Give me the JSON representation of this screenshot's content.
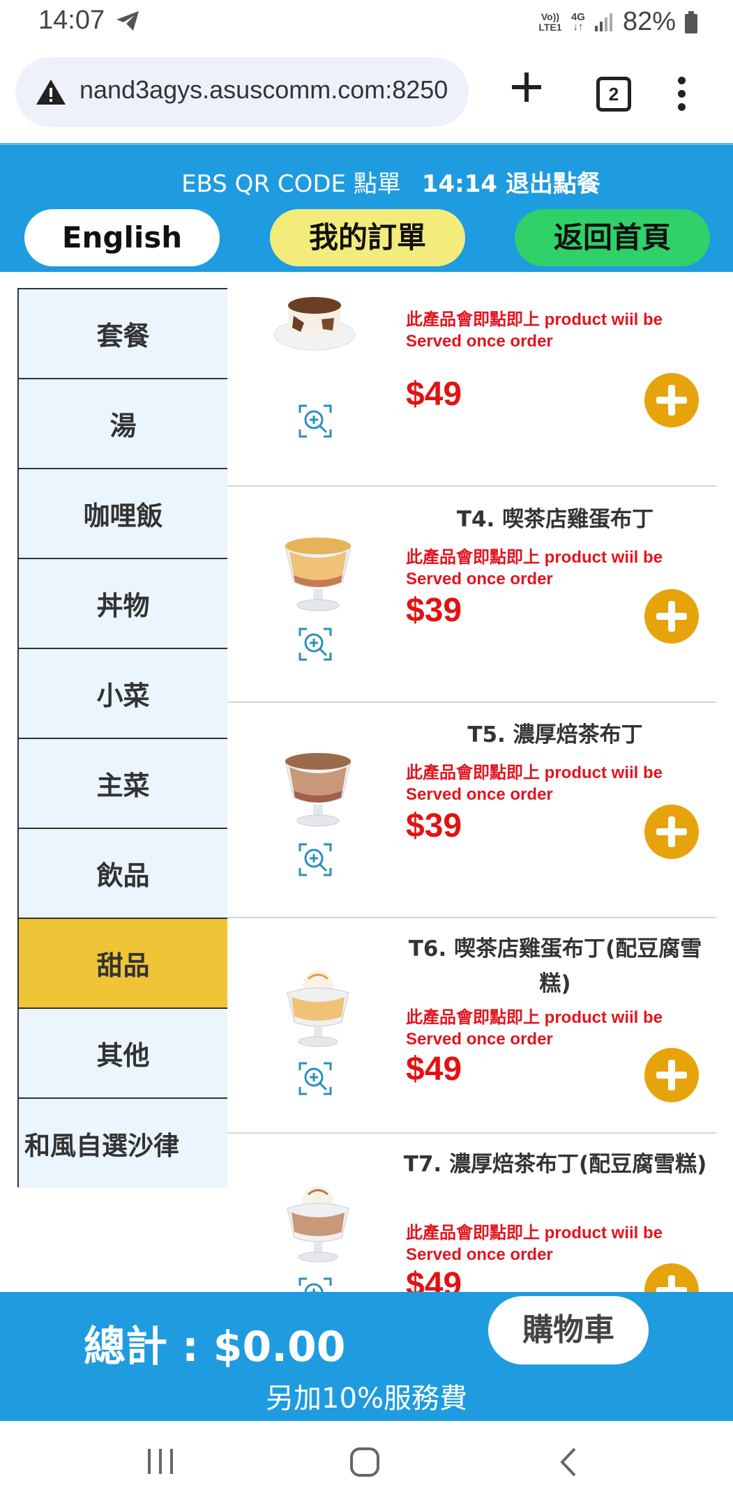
{
  "status_bar": {
    "time": "14:07",
    "volte_label": "Vo)) LTE1",
    "network": "4G",
    "battery": "82%"
  },
  "browser": {
    "url": "nand3agys.asuscomm.com:8250",
    "tab_count": "2"
  },
  "header": {
    "title": "EBS QR CODE 點單",
    "timer_exit": "14:14 退出點餐",
    "english_button": "English",
    "my_order_button": "我的訂單",
    "home_button": "返回首頁"
  },
  "categories": [
    {
      "label": "套餐",
      "active": false
    },
    {
      "label": "湯",
      "active": false
    },
    {
      "label": "咖哩飯",
      "active": false
    },
    {
      "label": "丼物",
      "active": false
    },
    {
      "label": "小菜",
      "active": false
    },
    {
      "label": "主菜",
      "active": false
    },
    {
      "label": "飲品",
      "active": false
    },
    {
      "label": "甜品",
      "active": true
    },
    {
      "label": "其他",
      "active": false
    },
    {
      "label": "和風自選沙律",
      "active": false
    }
  ],
  "products": [
    {
      "name": "",
      "note": "此產品會即點即上 product wiil be Served once order",
      "price": "$49"
    },
    {
      "name": "T4. 喫茶店雞蛋布丁",
      "note": "此產品會即點即上 product wiil be Served once order",
      "price": "$39"
    },
    {
      "name": "T5. 濃厚焙茶布丁",
      "note": "此產品會即點即上 product wiil be Served once order",
      "price": "$39"
    },
    {
      "name": "T6. 喫茶店雞蛋布丁(配豆腐雪糕)",
      "note": "此產品會即點即上 product wiil be Served once order",
      "price": "$49"
    },
    {
      "name": "T7. 濃厚焙茶布丁(配豆腐雪糕)",
      "note": "此產品會即點即上 product wiil be Served once order",
      "price": "$49"
    }
  ],
  "footer": {
    "total": "總計 : $0.00",
    "cart_button": "購物車",
    "service_fee": "另加10%服務費"
  },
  "colors": {
    "header_blue": "#1f9be0",
    "active_category": "#f0c437",
    "add_button": "#e6a30c",
    "price_red": "#e31212"
  },
  "icons": [
    "telegram-icon",
    "signal-icon",
    "battery-icon",
    "warning-icon",
    "new-tab-icon",
    "menu-icon",
    "zoom-icon",
    "add-icon",
    "recents-icon",
    "home-icon",
    "back-icon"
  ]
}
